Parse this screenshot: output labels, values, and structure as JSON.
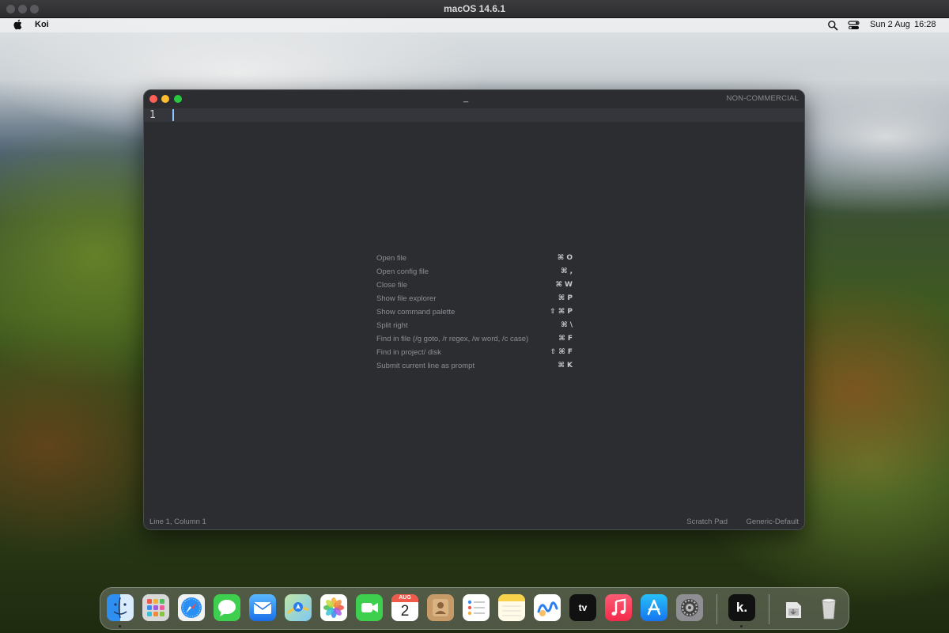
{
  "host": {
    "title": "macOS 14.6.1"
  },
  "menubar": {
    "app_name": "Koi",
    "date": "Sun 2 Aug",
    "time": "16:28"
  },
  "window": {
    "title": "_",
    "license": "NON-COMMERCIAL",
    "line_number": "1"
  },
  "shortcuts": [
    {
      "label": "Open file",
      "key": "⌘ O"
    },
    {
      "label": "Open config file",
      "key": "⌘ ,"
    },
    {
      "label": "Close file",
      "key": "⌘ W"
    },
    {
      "label": "Show file explorer",
      "key": "⌘ P"
    },
    {
      "label": "Show command palette",
      "key": "⇧ ⌘ P"
    },
    {
      "label": "Split right",
      "key": "⌘ \\"
    },
    {
      "label": "Find in file (/g goto, /r regex, /w word, /c case)",
      "key": "⌘ F"
    },
    {
      "label": "Find in project/ disk",
      "key": "⇧ ⌘ F"
    },
    {
      "label": "Submit current line as prompt",
      "key": "⌘ K"
    }
  ],
  "statusbar": {
    "position": "Line 1, Column 1",
    "mode": "Scratch Pad",
    "theme": "Generic-Default"
  },
  "dock": {
    "calendar_month": "AUG",
    "calendar_day": "2",
    "tv_label": "tv",
    "koi_label": "k.",
    "items": [
      "finder-icon",
      "launchpad-icon",
      "safari-icon",
      "messages-icon",
      "mail-icon",
      "maps-icon",
      "photos-icon",
      "facetime-icon",
      "calendar-icon",
      "contacts-icon",
      "reminders-icon",
      "notes-icon",
      "freeform-icon",
      "apple-tv-icon",
      "music-icon",
      "app-store-icon",
      "system-settings-icon",
      "koi-icon",
      "downloads-icon",
      "trash-icon"
    ]
  },
  "colors": {
    "editor_bg": "#2b2d31",
    "current_line": "#34363b",
    "cursor": "#8cc8ff",
    "close": "#fe5f57",
    "minimize": "#febc2e",
    "maximize": "#28c840"
  }
}
